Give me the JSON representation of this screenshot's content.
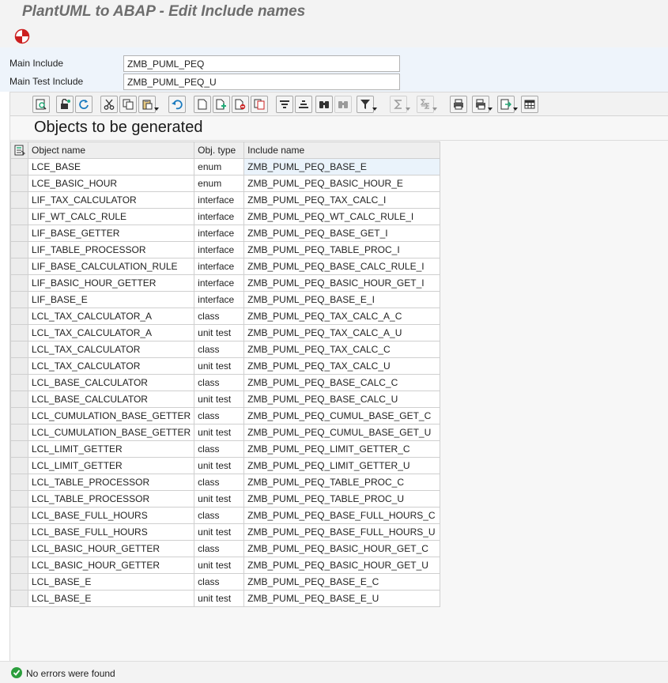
{
  "window": {
    "title": "PlantUML to ABAP - Edit Include names"
  },
  "app_toolbar": {
    "execute_icon": "execute-icon"
  },
  "form": {
    "main_include_label": "Main Include",
    "main_include_value": "ZMB_PUML_PEQ",
    "main_test_include_label": "Main Test Include",
    "main_test_include_value": "ZMB_PUML_PEQ_U"
  },
  "alv": {
    "toolbar_icons": [
      "details-icon",
      "filter-unlock-icon",
      "refresh-icon",
      "cut-icon",
      "copy-icon",
      "paste-icon",
      "undo-icon",
      "new-row-icon",
      "insert-row-icon",
      "delete-row-icon",
      "duplicate-row-icon",
      "sort-ascending-icon",
      "sort-descending-icon",
      "find-icon",
      "find-next-icon",
      "filter-icon",
      "sum-icon",
      "subtotal-icon",
      "print-icon",
      "views-icon",
      "export-icon",
      "layout-icon"
    ],
    "title": "Objects to be generated",
    "columns": [
      "Object name",
      "Obj. type",
      "Include name"
    ],
    "rows": [
      [
        "LCE_BASE",
        "enum",
        "ZMB_PUML_PEQ_BASE_E"
      ],
      [
        "LCE_BASIC_HOUR",
        "enum",
        "ZMB_PUML_PEQ_BASIC_HOUR_E"
      ],
      [
        "LIF_TAX_CALCULATOR",
        "interface",
        "ZMB_PUML_PEQ_TAX_CALC_I"
      ],
      [
        "LIF_WT_CALC_RULE",
        "interface",
        "ZMB_PUML_PEQ_WT_CALC_RULE_I"
      ],
      [
        "LIF_BASE_GETTER",
        "interface",
        "ZMB_PUML_PEQ_BASE_GET_I"
      ],
      [
        "LIF_TABLE_PROCESSOR",
        "interface",
        "ZMB_PUML_PEQ_TABLE_PROC_I"
      ],
      [
        "LIF_BASE_CALCULATION_RULE",
        "interface",
        "ZMB_PUML_PEQ_BASE_CALC_RULE_I"
      ],
      [
        "LIF_BASIC_HOUR_GETTER",
        "interface",
        "ZMB_PUML_PEQ_BASIC_HOUR_GET_I"
      ],
      [
        "LIF_BASE_E",
        "interface",
        "ZMB_PUML_PEQ_BASE_E_I"
      ],
      [
        "LCL_TAX_CALCULATOR_A",
        "class",
        "ZMB_PUML_PEQ_TAX_CALC_A_C"
      ],
      [
        "LCL_TAX_CALCULATOR_A",
        "unit test",
        "ZMB_PUML_PEQ_TAX_CALC_A_U"
      ],
      [
        "LCL_TAX_CALCULATOR",
        "class",
        "ZMB_PUML_PEQ_TAX_CALC_C"
      ],
      [
        "LCL_TAX_CALCULATOR",
        "unit test",
        "ZMB_PUML_PEQ_TAX_CALC_U"
      ],
      [
        "LCL_BASE_CALCULATOR",
        "class",
        "ZMB_PUML_PEQ_BASE_CALC_C"
      ],
      [
        "LCL_BASE_CALCULATOR",
        "unit test",
        "ZMB_PUML_PEQ_BASE_CALC_U"
      ],
      [
        "LCL_CUMULATION_BASE_GETTER",
        "class",
        "ZMB_PUML_PEQ_CUMUL_BASE_GET_C"
      ],
      [
        "LCL_CUMULATION_BASE_GETTER",
        "unit test",
        "ZMB_PUML_PEQ_CUMUL_BASE_GET_U"
      ],
      [
        "LCL_LIMIT_GETTER",
        "class",
        "ZMB_PUML_PEQ_LIMIT_GETTER_C"
      ],
      [
        "LCL_LIMIT_GETTER",
        "unit test",
        "ZMB_PUML_PEQ_LIMIT_GETTER_U"
      ],
      [
        "LCL_TABLE_PROCESSOR",
        "class",
        "ZMB_PUML_PEQ_TABLE_PROC_C"
      ],
      [
        "LCL_TABLE_PROCESSOR",
        "unit test",
        "ZMB_PUML_PEQ_TABLE_PROC_U"
      ],
      [
        "LCL_BASE_FULL_HOURS",
        "class",
        "ZMB_PUML_PEQ_BASE_FULL_HOURS_C"
      ],
      [
        "LCL_BASE_FULL_HOURS",
        "unit test",
        "ZMB_PUML_PEQ_BASE_FULL_HOURS_U"
      ],
      [
        "LCL_BASIC_HOUR_GETTER",
        "class",
        "ZMB_PUML_PEQ_BASIC_HOUR_GET_C"
      ],
      [
        "LCL_BASIC_HOUR_GETTER",
        "unit test",
        "ZMB_PUML_PEQ_BASIC_HOUR_GET_U"
      ],
      [
        "LCL_BASE_E",
        "class",
        "ZMB_PUML_PEQ_BASE_E_C"
      ],
      [
        "LCL_BASE_E",
        "unit test",
        "ZMB_PUML_PEQ_BASE_E_U"
      ]
    ]
  },
  "status": {
    "message": "No errors were found",
    "type": "success",
    "color": "#2b9e3c"
  }
}
